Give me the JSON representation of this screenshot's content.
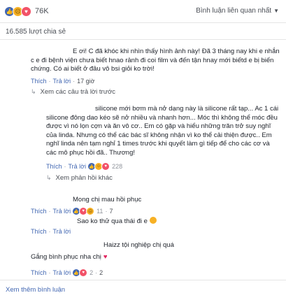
{
  "header": {
    "reaction_count": "76K",
    "sort_label": "Bình luận liên quan nhất",
    "shares": "16.585 lượt chia sẻ"
  },
  "actions": {
    "like": "Thích",
    "reply": "Trả lời"
  },
  "comments": [
    {
      "text": "E ơi! C đã khóc khi nhìn thấy hình ảnh này! Đã 3 tháng nay khi e nhắn c e đi bệnh viện chưa biết hnao rảnh đi coi film và đến tận hnay mới biếtd e bị biến chứng. Có ai biết ở đâu vô bsi giỏi ko trời!",
      "time": "17 giờ",
      "replies_label": "Xem các câu trả lời trước"
    },
    {
      "text": "silicone mới bơm mà nở dạng này là silicone rất tạp... Ac 1 cái silicone đông dao kéo sẽ nở nhiều và nhanh hơn... Móc thì không thể móc đều được vì nó lọn cợn và ăn vô cơ.. Em có gặp và hiểu những trăn trở suy nghĩ của linda. Nhưng có thể các bác sĩ không nhận vì ko thể cải thiện được.. Em nghĩ linda nên tạm nghỉ 1 times trước khi quyết làm gì tiếp để cho các cơ và các mô phục hồi đã.. Thương!",
      "likes": "228",
      "replies_label": "Xem phản hồi khác"
    },
    {
      "text": "Mong chị mau hồi phục",
      "likes": "11",
      "time": "7"
    },
    {
      "text": "Sao ko thử qua thái đi e"
    },
    {
      "text": "Haizz tội nghiệp chị quá"
    },
    {
      "text": "Gắng bình phục nha chị",
      "likes": "2",
      "time": "2"
    }
  ],
  "footer": {
    "more_label": "Xem thêm bình luận"
  }
}
